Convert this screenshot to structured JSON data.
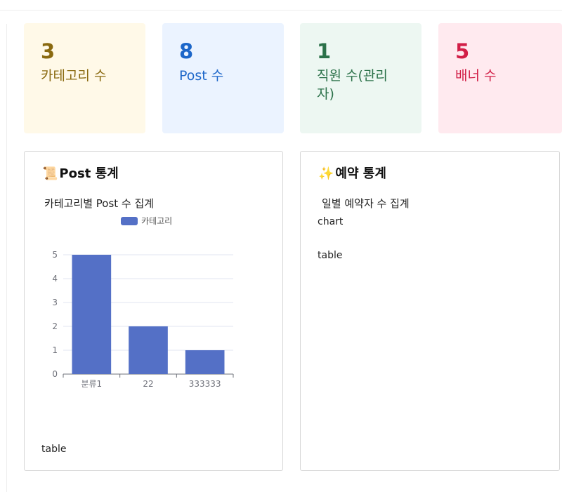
{
  "stats": [
    {
      "value": "3",
      "label": "카테고리 수"
    },
    {
      "value": "8",
      "label": "Post 수"
    },
    {
      "value": "1",
      "label": "직원 수(관리자)"
    },
    {
      "value": "5",
      "label": "배너 수"
    }
  ],
  "post_card": {
    "icon": "📜",
    "title": "Post 통계",
    "subtitle": "카테고리별 Post 수 집계",
    "table_placeholder": "table"
  },
  "reservation_card": {
    "icon": "✨",
    "title": "예약 통계",
    "subtitle": "일별 예약자 수 집계",
    "chart_placeholder": "chart",
    "table_placeholder": "table"
  },
  "chart_data": {
    "type": "bar",
    "categories": [
      "분류1",
      "22",
      "333333"
    ],
    "series": [
      {
        "name": "카테고리",
        "values": [
          5,
          2,
          1
        ]
      }
    ],
    "title": "",
    "xlabel": "",
    "ylabel": "",
    "ylim": [
      0,
      5
    ],
    "yticks": [
      0,
      1,
      2,
      3,
      4,
      5
    ],
    "grid": true,
    "legend": "top-center",
    "color": "#5470c6"
  }
}
